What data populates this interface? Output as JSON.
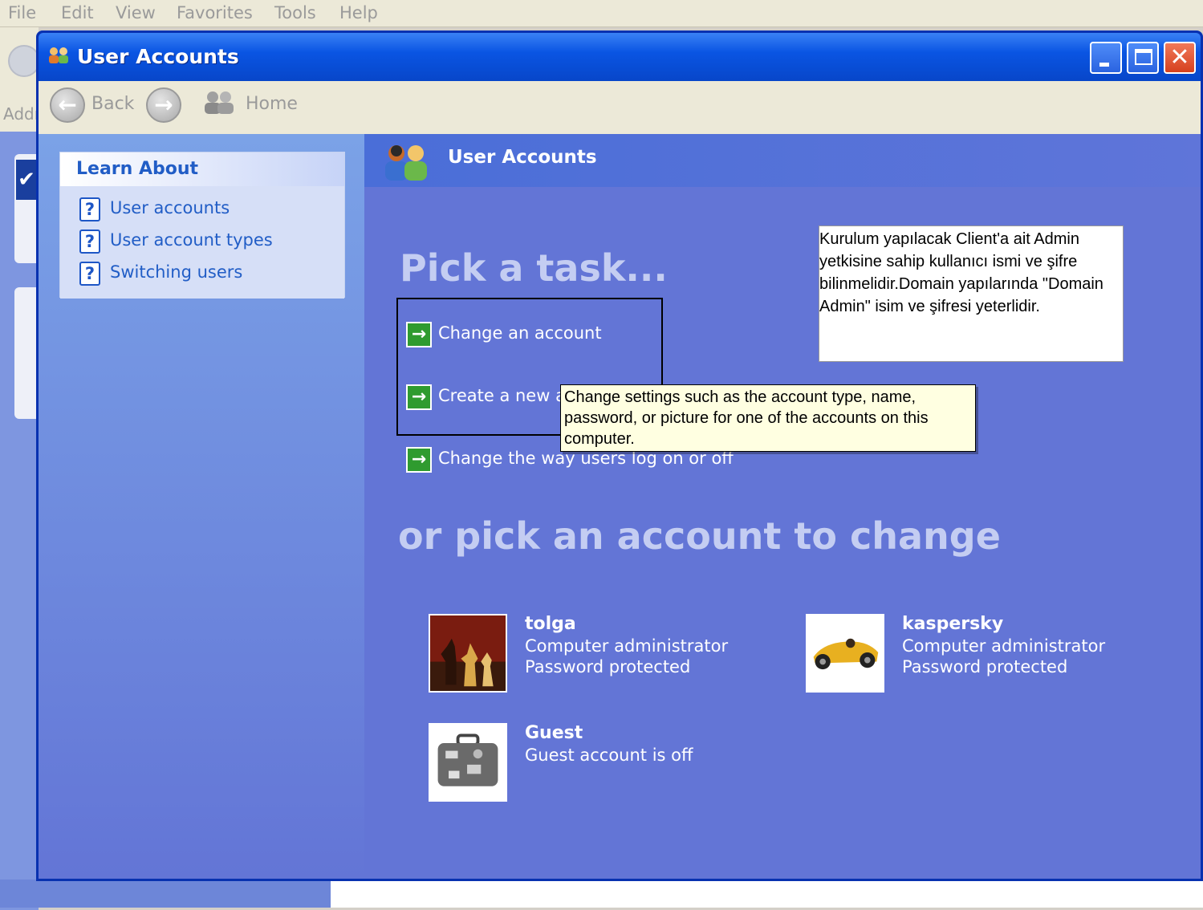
{
  "background_app": {
    "menu": [
      "File",
      "Edit",
      "View",
      "Favorites",
      "Tools",
      "Help"
    ],
    "address_label": "Addr"
  },
  "window": {
    "title": "User Accounts"
  },
  "toolbar": {
    "back_label": "Back",
    "home_label": "Home"
  },
  "learn_about": {
    "heading": "Learn About",
    "items": [
      {
        "label": "User accounts",
        "icon": "help-icon"
      },
      {
        "label": "User account types",
        "icon": "help-icon"
      },
      {
        "label": "Switching users",
        "icon": "help-icon"
      }
    ]
  },
  "content": {
    "header": "User Accounts",
    "pick_task": "Pick a task...",
    "tasks": [
      {
        "label": "Change an account"
      },
      {
        "label": "Create a new account"
      },
      {
        "label": "Change the way users log on or off"
      }
    ],
    "pick_account": "or pick an account to change",
    "accounts": [
      {
        "name": "tolga",
        "type": "Computer administrator",
        "status": "Password protected",
        "picture": "chess-icon"
      },
      {
        "name": "kaspersky",
        "type": "Computer administrator",
        "status": "Password protected",
        "picture": "race-car-icon"
      },
      {
        "name": "Guest",
        "status": "Guest account is off",
        "picture": "suitcase-icon"
      }
    ]
  },
  "note": {
    "text": "Kurulum yapılacak Client'a ait Admin yetkisine sahip kullanıcı ismi ve şifre bilinmelidir.Domain yapılarında \"Domain Admin\" isim ve şifresi yeterlidir."
  },
  "tooltip": {
    "text": "Change settings such as the account type, name, password, or picture for one of the accounts on this computer."
  },
  "colors": {
    "title_bar": "#0a55e3",
    "content_bg": "#6375d6",
    "task_icon": "#2f9b2f",
    "link": "#215dc6"
  }
}
